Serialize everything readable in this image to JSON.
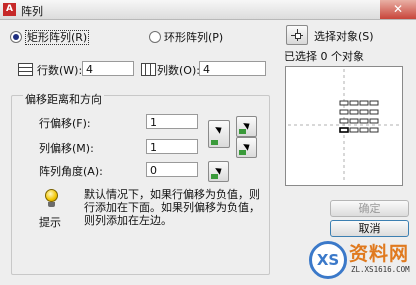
{
  "window": {
    "title": "阵列",
    "close_glyph": "✕",
    "app_icon_glyph": "A"
  },
  "mode": {
    "rect_label": "矩形阵列(R)",
    "polar_label": "环形阵列(P)",
    "selected": "rect"
  },
  "rows": {
    "label": "行数(W):",
    "value": "4"
  },
  "cols": {
    "label": "列数(O):",
    "value": "4"
  },
  "offset_group": {
    "title": "偏移距离和方向",
    "row_offset_label": "行偏移(F):",
    "row_offset_value": "1",
    "col_offset_label": "列偏移(M):",
    "col_offset_value": "1",
    "angle_label": "阵列角度(A):",
    "angle_value": "0"
  },
  "tip": {
    "caption": "提示",
    "text": "默认情况下，如果行偏移为负值，则行添加在下面。如果列偏移为负值，则列添加在左边。"
  },
  "selection": {
    "button_label": "选择对象(S)",
    "status": "已选择 0 个对象"
  },
  "buttons": {
    "ok": "确定",
    "cancel": "取消"
  },
  "watermark": {
    "brand": "资料网",
    "url": "ZL.XS1616.COM",
    "logo_text": "XS"
  },
  "colors": {
    "accent": "#1f2f80",
    "watermark_blue": "#3b79c9",
    "watermark_orange": "#e07a1f"
  }
}
